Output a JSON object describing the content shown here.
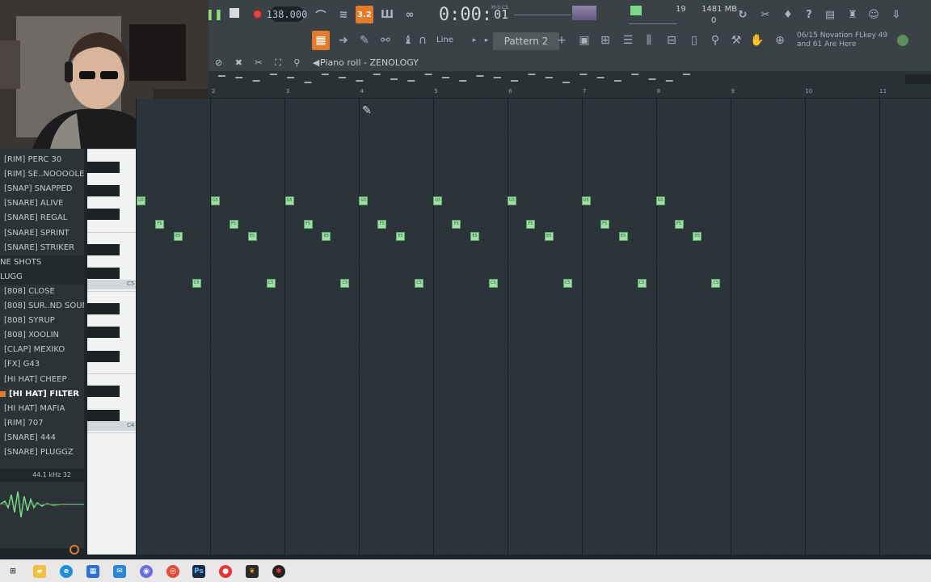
{
  "toolbar": {
    "tempo": "138.000",
    "time_main": "0:00:",
    "time_small": "01",
    "time_caption": "M:S:CS",
    "cpu": "19",
    "memory": "1481 MB",
    "polyphony": "0",
    "line_mode": "Line",
    "pattern": "Pattern 2",
    "hint_line1": "06/15  Novation FLkey 49",
    "hint_line2": "and 61 Are Here",
    "snap_label": "3.2"
  },
  "piano_roll": {
    "title": "Piano roll - ZENOLOGY",
    "ruler": [
      "2",
      "3",
      "4",
      "5",
      "6",
      "7",
      "8",
      "9",
      "10",
      "11"
    ],
    "key_labels": [
      "C5",
      "C4"
    ]
  },
  "browser": {
    "items": [
      {
        "label": "[RIM] PERC 30",
        "type": "file"
      },
      {
        "label": "[RIM] SE..NOOOOLES",
        "type": "file"
      },
      {
        "label": "[SNAP] SNAPPED",
        "type": "file"
      },
      {
        "label": "[SNARE] ALIVE",
        "type": "file"
      },
      {
        "label": "[SNARE] REGAL",
        "type": "file"
      },
      {
        "label": "[SNARE] SPRINT",
        "type": "file"
      },
      {
        "label": "[SNARE] STRIKER",
        "type": "file"
      },
      {
        "label": "NE SHOTS",
        "type": "folder"
      },
      {
        "label": "LUGG",
        "type": "folder"
      },
      {
        "label": "[808] CLOSE",
        "type": "file"
      },
      {
        "label": "[808] SUR..ND SOUND",
        "type": "file"
      },
      {
        "label": "[808] SYRUP",
        "type": "file"
      },
      {
        "label": "[808] XOOLIN",
        "type": "file"
      },
      {
        "label": "[CLAP] MEXIKO",
        "type": "file"
      },
      {
        "label": "[FX] G43",
        "type": "file"
      },
      {
        "label": "[HI HAT] CHEEP",
        "type": "file"
      },
      {
        "label": "[HI HAT] FILTER",
        "type": "selected"
      },
      {
        "label": "[HI HAT] MAFIA",
        "type": "file"
      },
      {
        "label": "[RIM] 707",
        "type": "file"
      },
      {
        "label": "[SNARE] 444",
        "type": "file"
      },
      {
        "label": "[SNARE] PLUGGZ",
        "type": "file"
      }
    ],
    "sample_info": "44.1 kHz 32"
  },
  "notes": {
    "bars": [
      2,
      3,
      4,
      5,
      6,
      7,
      8,
      9
    ],
    "pattern": [
      {
        "step": 0,
        "key": "G5"
      },
      {
        "step": 1,
        "key": "F5"
      },
      {
        "step": 2,
        "key": "E5"
      },
      {
        "step": 3,
        "key": "C5"
      }
    ]
  },
  "colors": {
    "accent": "#e27b2b",
    "note": "#9fe0a9",
    "grid_bg": "#2b3438"
  }
}
